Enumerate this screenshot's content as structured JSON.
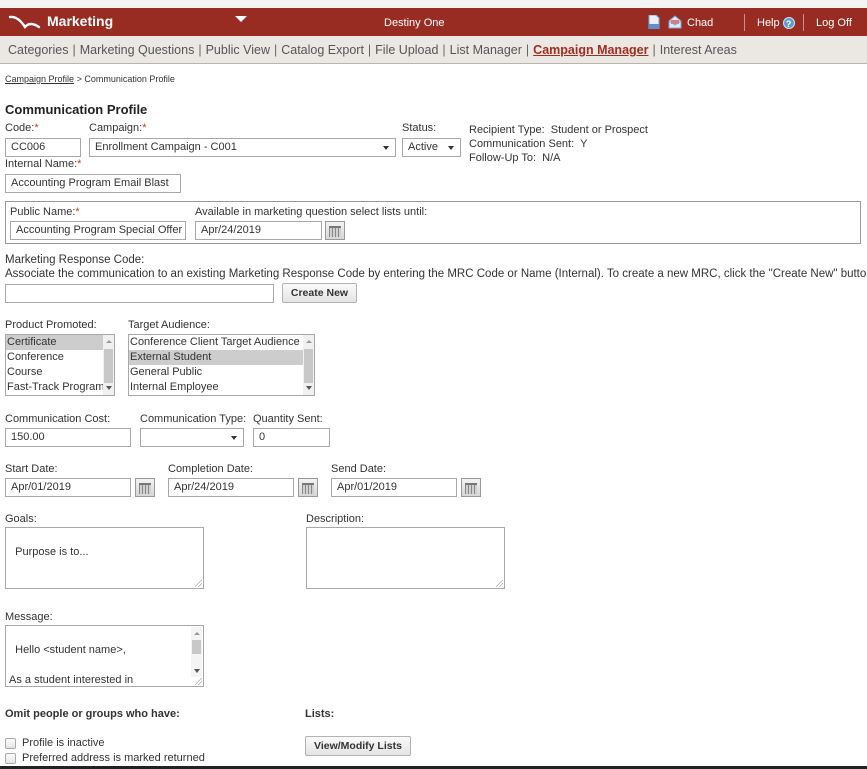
{
  "header": {
    "app_title": "Marketing",
    "product_name": "Destiny One",
    "user_name": "Chad",
    "help_label": "Help",
    "help_icon_glyph": "?",
    "logoff_label": "Log Off",
    "icons": [
      "logo-swoosh-icon",
      "document-icon",
      "envelope-icon",
      "help-icon"
    ]
  },
  "subnav": {
    "items": [
      {
        "label": "Categories",
        "active": false
      },
      {
        "label": "Marketing Questions",
        "active": false
      },
      {
        "label": "Public View",
        "active": false
      },
      {
        "label": "Catalog Export",
        "active": false
      },
      {
        "label": "File Upload",
        "active": false
      },
      {
        "label": "List Manager",
        "active": false
      },
      {
        "label": "Campaign Manager",
        "active": true
      },
      {
        "label": "Interest Areas",
        "active": false
      }
    ],
    "separator": "|"
  },
  "breadcrumb": {
    "parent": "Campaign Profile",
    "separator": ">",
    "current": "Communication Profile"
  },
  "page_title": "Communication Profile",
  "form": {
    "code": {
      "label": "Code:",
      "required_mark": "*",
      "value": "CC006"
    },
    "campaign": {
      "label": "Campaign:",
      "required_mark": "*",
      "value": "Enrollment Campaign - C001"
    },
    "status": {
      "label": "Status:",
      "value": "Active"
    },
    "info": {
      "recipient_type_label": "Recipient Type:",
      "recipient_type_value": "Student or Prospect",
      "communication_sent_label": "Communication Sent:",
      "communication_sent_value": "Y",
      "follow_up_label": "Follow-Up To:",
      "follow_up_value": "N/A"
    },
    "internal_name": {
      "label": "Internal Name:",
      "required_mark": "*",
      "value": "Accounting Program Email Blast"
    },
    "public_name": {
      "label": "Public Name:",
      "required_mark": "*",
      "value": "Accounting Program Special Offer"
    },
    "available_until": {
      "label": "Available in marketing question select lists until:",
      "value": "Apr/24/2019"
    },
    "mrc": {
      "label": "Marketing Response Code:",
      "help_text": "Associate the communication to an existing Marketing Response Code by entering the MRC Code or Name (Internal). To create a new MRC, click the \"Create New\" button.",
      "value": "",
      "create_button": "Create New"
    },
    "product_promoted": {
      "label": "Product Promoted:",
      "options": [
        "Certificate",
        "Conference",
        "Course",
        "Fast-Track Program"
      ],
      "selected": "Certificate"
    },
    "target_audience": {
      "label": "Target Audience:",
      "options": [
        "Conference Client Target Audience",
        "External Student",
        "General Public",
        "Internal Employee"
      ],
      "selected": "External Student"
    },
    "communication_cost": {
      "label": "Communication Cost:",
      "value": "150.00"
    },
    "communication_type": {
      "label": "Communication Type:",
      "value": ""
    },
    "quantity_sent": {
      "label": "Quantity Sent:",
      "value": "0"
    },
    "start_date": {
      "label": "Start Date:",
      "value": "Apr/01/2019"
    },
    "completion_date": {
      "label": "Completion Date:",
      "value": "Apr/24/2019"
    },
    "send_date": {
      "label": "Send Date:",
      "value": "Apr/01/2019"
    },
    "goals": {
      "label": "Goals:",
      "value": "Purpose is to..."
    },
    "description": {
      "label": "Description:",
      "value": ""
    },
    "message": {
      "label": "Message:",
      "value": "Hello <student name>,\n\nAs a student interested in Accounting, we thought you'd like"
    },
    "omit": {
      "heading": "Omit people or groups who have:",
      "options": [
        {
          "label": "Profile is inactive",
          "checked": false
        },
        {
          "label": "Preferred address is marked returned",
          "checked": false
        }
      ]
    },
    "lists": {
      "heading": "Lists:",
      "button": "View/Modify Lists"
    }
  },
  "colors": {
    "header_bg": "#982c22",
    "subnav_bg": "#ebe8e3",
    "active_nav": "#a22c20",
    "required": "#c0392b"
  }
}
